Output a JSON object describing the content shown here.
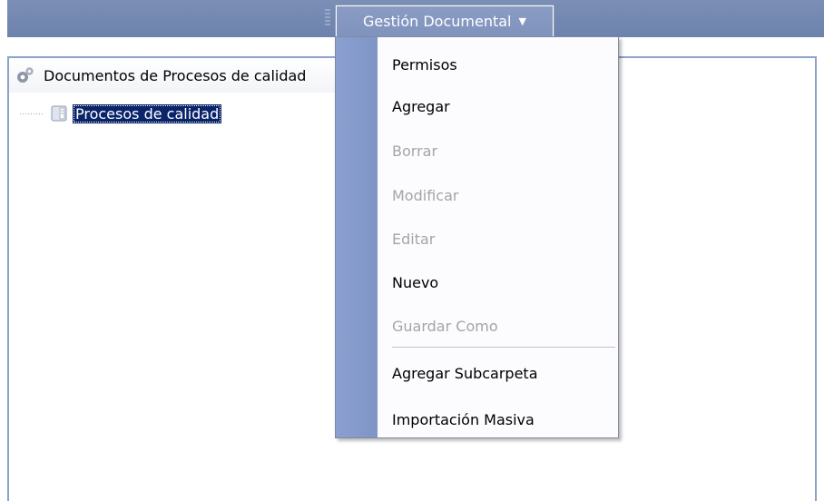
{
  "menubar": {
    "menu_title": "Gestión Documental"
  },
  "panel": {
    "tab_title": "Documentos de Procesos de calidad",
    "tree": [
      {
        "label": "Procesos de calidad",
        "selected": true
      }
    ]
  },
  "dropdown": {
    "items": [
      {
        "label": "Permisos",
        "enabled": true
      },
      {
        "label": "Agregar",
        "enabled": true
      },
      {
        "label": "Borrar",
        "enabled": false
      },
      {
        "label": "Modificar",
        "enabled": false
      },
      {
        "label": "Editar",
        "enabled": false
      },
      {
        "label": "Nuevo",
        "enabled": true
      },
      {
        "label": "Guardar Como",
        "enabled": false
      },
      {
        "label": "Agregar Subcarpeta",
        "enabled": true
      },
      {
        "label": "Importación Masiva",
        "enabled": true
      }
    ]
  },
  "colors": {
    "toolbar": "#6d82ad",
    "menu_gutter": "#8ba0cf",
    "selection": "#0a246a",
    "disabled_text": "#a5a5a5"
  }
}
